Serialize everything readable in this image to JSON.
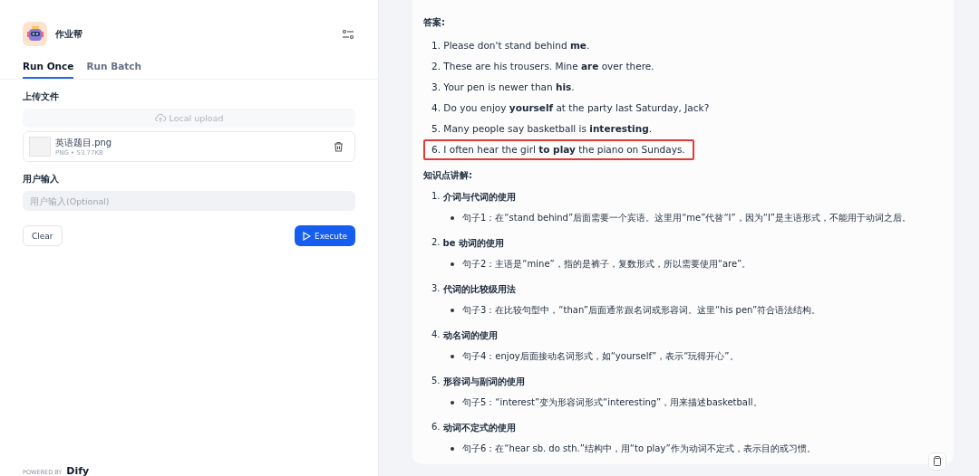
{
  "app": {
    "name": "作业帮"
  },
  "tabs": [
    {
      "label": "Run Once",
      "selected": true
    },
    {
      "label": "Run Batch",
      "selected": false
    }
  ],
  "upload": {
    "label": "上传文件",
    "button": "Local upload",
    "file": {
      "name": "英语题目.png",
      "meta": "PNG • 53.77KB"
    }
  },
  "user_input": {
    "label": "用户输入",
    "placeholder": "用户输入(Optional)"
  },
  "buttons": {
    "clear": "Clear",
    "execute": "Execute"
  },
  "footer": {
    "powered_by": "POWERED BY",
    "brand": "Dify"
  },
  "result": {
    "answers_title": "答案:",
    "answers": [
      {
        "text": "1. Please don't stand behind **me**.",
        "highlighted": false
      },
      {
        "text": "2. These are his trousers. Mine **are** over there.",
        "highlighted": false
      },
      {
        "text": "3. Your pen is newer than **his**.",
        "highlighted": false
      },
      {
        "text": "4. Do you enjoy **yourself** at the party last Saturday, Jack?",
        "highlighted": false
      },
      {
        "text": "5. Many people say basketball is **interesting**.",
        "highlighted": false
      },
      {
        "text": "6. I often hear the girl **to play** the piano on Sundays.",
        "highlighted": true
      }
    ],
    "points_title": "知识点讲解:",
    "points": [
      {
        "number": "1.",
        "title": "介词与代词的使用",
        "bullet": "句子1：在“stand behind”后面需要一个宾语。这里用“me”代替“I”，因为“I”是主语形式，不能用于动词之后。"
      },
      {
        "number": "2.",
        "title": "be 动词的使用",
        "bullet": "句子2：主语是“mine”，指的是裤子，复数形式，所以需要使用“are”。"
      },
      {
        "number": "3.",
        "title": "代词的比较级用法",
        "bullet": "句子3：在比较句型中，“than”后面通常跟名词或形容词。这里“his pen”符合语法结构。"
      },
      {
        "number": "4.",
        "title": "动名词的使用",
        "bullet": "句子4：enjoy后面接动名词形式，如“yourself”，表示“玩得开心”。"
      },
      {
        "number": "5.",
        "title": "形容词与副词的使用",
        "bullet": "句子5：“interest”变为形容词形式“interesting”，用来描述basketball。"
      },
      {
        "number": "6.",
        "title": "动词不定式的使用",
        "bullet": "句子6：在“hear sb. do sth.”结构中，用“to play”作为动词不定式，表示目的或习惯。"
      }
    ]
  }
}
